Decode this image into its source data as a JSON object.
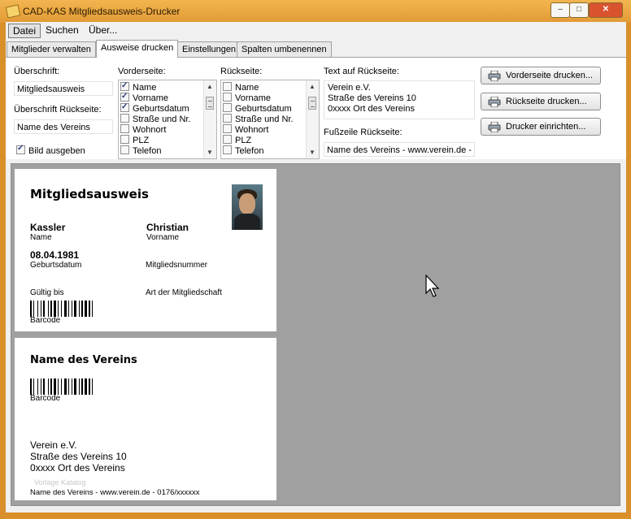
{
  "window": {
    "title": "CAD-KAS Mitgliedsausweis-Drucker"
  },
  "menu": [
    "Datei",
    "Suchen",
    "Über..."
  ],
  "tabs": [
    "Mitglieder verwalten",
    "Ausweise drucken",
    "Einstellungen",
    "Spalten umbenennen"
  ],
  "selected_tab": "Ausweise drucken",
  "form": {
    "heading_label": "Überschrift:",
    "heading_value": "Mitgliedsausweis",
    "back_heading_label": "Überschrift Rückseite:",
    "back_heading_value": "Name des Vereins",
    "show_image_label": "Bild ausgeben",
    "show_image_checked": true,
    "front_label": "Vorderseite:",
    "back_label": "Rückseite:",
    "front_fields": [
      {
        "label": "Name",
        "checked": true
      },
      {
        "label": "Vorname",
        "checked": true
      },
      {
        "label": "Geburtsdatum",
        "checked": true
      },
      {
        "label": "Straße und Nr.",
        "checked": false
      },
      {
        "label": "Wohnort",
        "checked": false
      },
      {
        "label": "PLZ",
        "checked": false
      },
      {
        "label": "Telefon",
        "checked": false
      }
    ],
    "back_fields": [
      {
        "label": "Name",
        "checked": false
      },
      {
        "label": "Vorname",
        "checked": false
      },
      {
        "label": "Geburtsdatum",
        "checked": false
      },
      {
        "label": "Straße und Nr.",
        "checked": false
      },
      {
        "label": "Wohnort",
        "checked": false
      },
      {
        "label": "PLZ",
        "checked": false
      },
      {
        "label": "Telefon",
        "checked": false
      }
    ],
    "back_text_label": "Text auf Rückseite:",
    "back_text_lines": [
      "Verein e.V.",
      "Straße des Vereins 10",
      "0xxxx Ort des Vereins"
    ],
    "footer_label": "Fußzeile Rückseite:",
    "footer_value": "Name des Vereins - www.verein.de -"
  },
  "buttons": {
    "print_front": "Vorderseite drucken...",
    "print_back": "Rückseite drucken...",
    "setup_printer": "Drucker einrichten..."
  },
  "front_card": {
    "title": "Mitgliedsausweis",
    "last_name": "Kassler",
    "last_name_label": "Name",
    "first_name": "Christian",
    "first_name_label": "Vorname",
    "birth_date": "08.04.1981",
    "birth_date_label": "Geburtsdatum",
    "member_number_label": "Mitgliedsnummer",
    "valid_until_label": "Gültig bis",
    "membership_type_label": "Art der Mitgliedschaft",
    "barcode_label": "Barcode"
  },
  "back_card": {
    "title": "Name des Vereins",
    "barcode_label": "Barcode",
    "address_lines": [
      "Verein e.V.",
      "Straße des Vereins 10",
      "0xxxx Ort des Vereins"
    ],
    "watermark": "Vorlage Katalog",
    "footer": "Name des Vereins - www.verein.de - 0176/xxxxxx"
  },
  "icons": [
    "app-icon",
    "printer-icon",
    "mouse-cursor-icon",
    "minimize-icon",
    "maximize-icon",
    "close-icon"
  ]
}
